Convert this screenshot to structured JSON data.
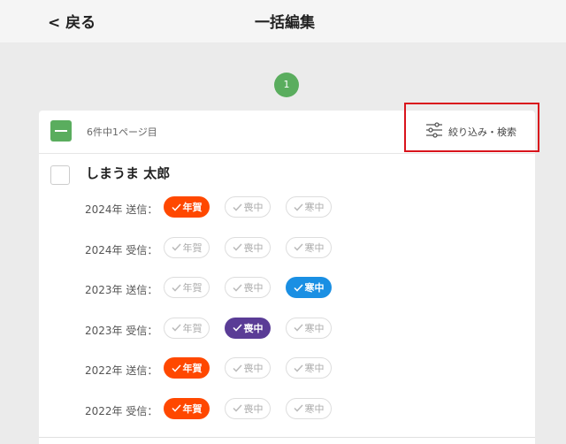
{
  "header": {
    "back_label": "< 戻る",
    "title": "一括編集"
  },
  "pagination": {
    "current_page": "1"
  },
  "list": {
    "summary": "6件中1ページ目",
    "filter_label": "絞り込み・検索",
    "select_all_state": "indeterminate"
  },
  "person": {
    "name": "しまうま 太郎",
    "rows": [
      {
        "label": "2024年 送信：",
        "tags": [
          {
            "text": "年賀",
            "selected": true,
            "color": "#ff4800"
          },
          {
            "text": "喪中",
            "selected": false
          },
          {
            "text": "寒中",
            "selected": false
          }
        ]
      },
      {
        "label": "2024年 受信：",
        "tags": [
          {
            "text": "年賀",
            "selected": false
          },
          {
            "text": "喪中",
            "selected": false
          },
          {
            "text": "寒中",
            "selected": false
          }
        ]
      },
      {
        "label": "2023年 送信：",
        "tags": [
          {
            "text": "年賀",
            "selected": false
          },
          {
            "text": "喪中",
            "selected": false
          },
          {
            "text": "寒中",
            "selected": true,
            "color": "#1a8fe3"
          }
        ]
      },
      {
        "label": "2023年 受信：",
        "tags": [
          {
            "text": "年賀",
            "selected": false
          },
          {
            "text": "喪中",
            "selected": true,
            "color": "#5a3c96"
          },
          {
            "text": "寒中",
            "selected": false
          }
        ]
      },
      {
        "label": "2022年 送信：",
        "tags": [
          {
            "text": "年賀",
            "selected": true,
            "color": "#ff4800"
          },
          {
            "text": "喪中",
            "selected": false
          },
          {
            "text": "寒中",
            "selected": false
          }
        ]
      },
      {
        "label": "2022年 受信：",
        "tags": [
          {
            "text": "年賀",
            "selected": true,
            "color": "#ff4800"
          },
          {
            "text": "喪中",
            "selected": false
          },
          {
            "text": "寒中",
            "selected": false
          }
        ]
      }
    ]
  },
  "colors": {
    "accent_green": "#5aad5e",
    "highlight_red": "#d9141c"
  }
}
